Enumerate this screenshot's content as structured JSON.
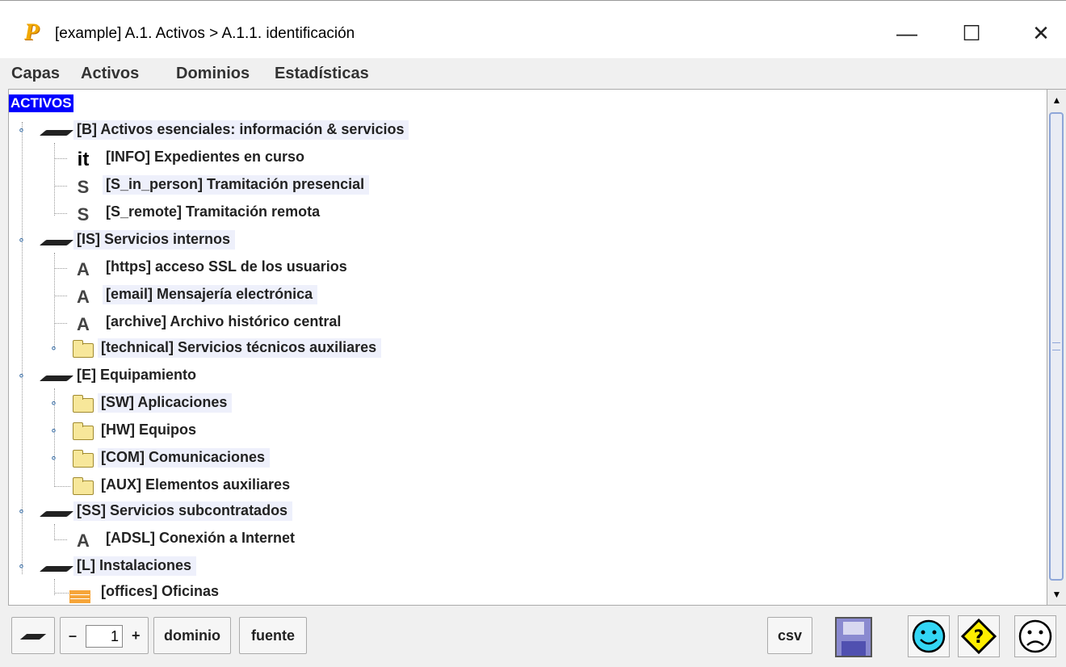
{
  "window": {
    "title": "[example] A.1. Activos > A.1.1. identificación",
    "app_logo_letter": "P",
    "minimize_glyph": "—",
    "maximize_glyph": "☐",
    "close_glyph": "✕"
  },
  "menu": [
    "Capas",
    "Activos",
    "Dominios",
    "Estadísticas"
  ],
  "tree": {
    "root_label": "ACTIVOS",
    "nodes": [
      {
        "label": "[B] Activos esenciales: información & servicios",
        "icon": "layer-icon"
      },
      {
        "label": "[INFO] Expedientes en curso",
        "icon": "info-letter",
        "letter": "it"
      },
      {
        "label": "[S_in_person] Tramitación presencial",
        "icon": "service-letter",
        "letter": "S"
      },
      {
        "label": "[S_remote] Tramitación remota",
        "icon": "service-letter",
        "letter": "S"
      },
      {
        "label": "[IS] Servicios internos",
        "icon": "layer-icon"
      },
      {
        "label": "[https] acceso SSL de los usuarios",
        "icon": "asset-letter",
        "letter": "A"
      },
      {
        "label": "[email] Mensajería electrónica",
        "icon": "asset-letter",
        "letter": "A"
      },
      {
        "label": "[archive] Archivo histórico central",
        "icon": "asset-letter",
        "letter": "A"
      },
      {
        "label": "[technical] Servicios técnicos auxiliares",
        "icon": "folder-icon"
      },
      {
        "label": "[E] Equipamiento",
        "icon": "layer-icon"
      },
      {
        "label": "[SW] Aplicaciones",
        "icon": "folder-icon"
      },
      {
        "label": "[HW] Equipos",
        "icon": "folder-icon"
      },
      {
        "label": "[COM] Comunicaciones",
        "icon": "folder-icon"
      },
      {
        "label": "[AUX] Elementos auxiliares",
        "icon": "folder-icon"
      },
      {
        "label": "[SS] Servicios subcontratados",
        "icon": "layer-icon"
      },
      {
        "label": "[ADSL] Conexión a Internet",
        "icon": "asset-letter",
        "letter": "A"
      },
      {
        "label": "[L] Instalaciones",
        "icon": "layer-icon"
      },
      {
        "label": "[offices] Oficinas",
        "icon": "brick-icon"
      }
    ]
  },
  "bottom": {
    "minus": "–",
    "level_value": "1",
    "plus": "+",
    "dominio_label": "dominio",
    "fuente_label": "fuente",
    "csv_label": "csv"
  },
  "colors": {
    "root_bg": "#0000ff",
    "smiley_happy": "#33d6f5",
    "warning": "#ffee00",
    "label_highlight": "#eef0fb"
  }
}
